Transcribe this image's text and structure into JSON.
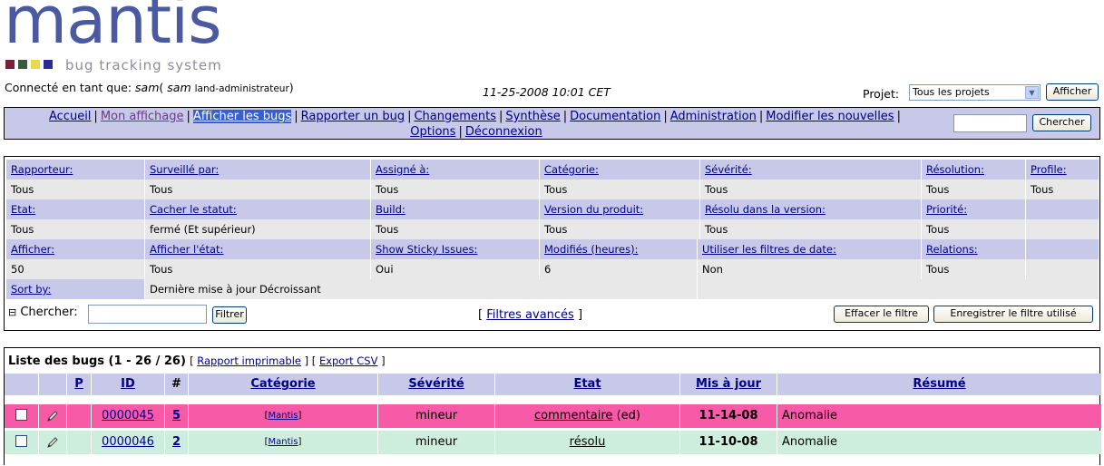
{
  "logo": {
    "word": "mantis",
    "tagline": "bug tracking system",
    "square_colors": [
      "#7a1e3a",
      "#3a5a3a",
      "#e8d84a",
      "#2a2a9a"
    ]
  },
  "login": {
    "prefix": "Connecté en tant que:",
    "user": "sam",
    "realname": "sam",
    "role": "land-administrateur"
  },
  "datetime": "11-25-2008 10:01 CET",
  "project": {
    "label": "Projet:",
    "selected": "Tous les projets",
    "button": "Afficher"
  },
  "menu": {
    "items": [
      "Accueil",
      "Mon affichage",
      "Afficher les bugs",
      "Rapporter un bug",
      "Changements",
      "Synthèse",
      "Documentation",
      "Administration",
      "Modifier les nouvelles",
      "Options",
      "Déconnexion"
    ],
    "search_button": "Chercher"
  },
  "filters": {
    "row1_headers": [
      "Rapporteur:",
      "Surveillé par:",
      "Assigné à:",
      "Catégorie:",
      "Sévérité:",
      "Résolution:",
      "Profile:"
    ],
    "row1_values": [
      "Tous",
      "Tous",
      "Tous",
      "Tous",
      "Tous",
      "Tous",
      "Tous"
    ],
    "row2_headers": [
      "Etat:",
      "Cacher le statut:",
      "Build:",
      "Version du produit:",
      "Résolu dans la version:",
      "Priorité:"
    ],
    "row2_values": [
      "Tous",
      "fermé (Et supérieur)",
      "Tous",
      "Tous",
      "Tous",
      "Tous"
    ],
    "row3_headers": [
      "Afficher:",
      "Afficher l'état:",
      "Show Sticky Issues:",
      "Modifiés (heures):",
      "Utiliser les filtres de date:",
      "Relations:"
    ],
    "row3_values": [
      "50",
      "Tous",
      "Oui",
      "6",
      "Non",
      "Tous"
    ],
    "sort_label": "Sort by:",
    "sort_value": "Dernière mise à jour Décroissant",
    "search_label": "Chercher:",
    "filter_button": "Filtrer",
    "advanced_link": "Filtres avancés",
    "clear_button": "Effacer le filtre",
    "save_button": "Enregistrer le filtre utilisé"
  },
  "buglist": {
    "title": "Liste des bugs (1 - 26 / 26)",
    "print_link": "Rapport imprimable",
    "csv_link": "Export CSV",
    "columns": [
      "P",
      "ID",
      "#",
      "Catégorie",
      "Sévérité",
      "Etat",
      "Mis à jour",
      "Résumé"
    ],
    "rows": [
      {
        "id": "0000045",
        "notes": "5",
        "category": "Mantis",
        "severity": "mineur",
        "status": "commentaire",
        "status_suffix": "(ed)",
        "updated": "11-14-08",
        "summary": "Anomalie",
        "color": "#f75aa6"
      },
      {
        "id": "0000046",
        "notes": "2",
        "category": "Mantis",
        "severity": "mineur",
        "status": "résolu",
        "status_suffix": "",
        "updated": "11-10-08",
        "summary": "Anomalie",
        "color": "#cdeedd"
      }
    ]
  },
  "colors": {
    "header_bg": "#c8c8e8",
    "value_bg": "#e8e8e8",
    "link": "#00008b"
  }
}
